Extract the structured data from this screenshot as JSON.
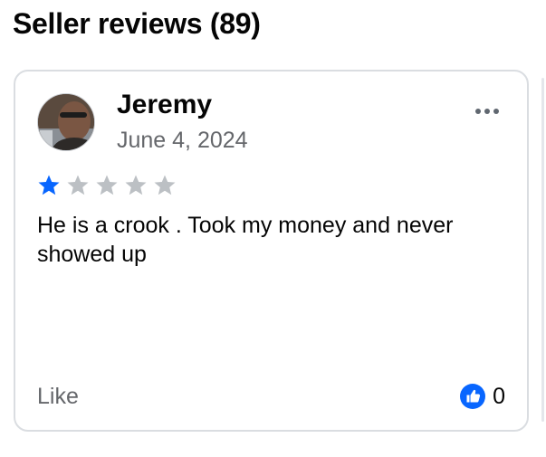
{
  "section": {
    "title": "Seller reviews (89)"
  },
  "review": {
    "reviewer_name": "Jeremy",
    "date": "June 4, 2024",
    "rating": 1,
    "rating_max": 5,
    "text": "He is a crook . Took my money and never showed up",
    "like_label": "Like",
    "like_count": "0",
    "avatar_icon": "profile-photo",
    "more_icon": "more-options-icon",
    "like_icon": "thumbs-up-icon"
  },
  "colors": {
    "star_filled": "#0866ff",
    "star_empty": "#bcc0c4",
    "like_badge": "#0866ff",
    "secondary_text": "#65676b",
    "card_border": "#dadde1"
  }
}
